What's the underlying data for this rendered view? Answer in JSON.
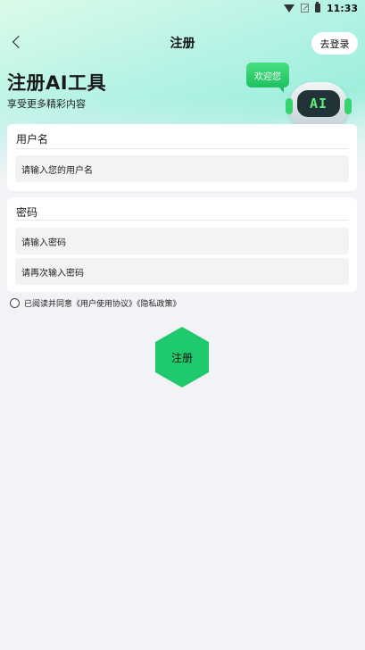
{
  "status_bar": {
    "time": "11:33",
    "icons": [
      "wifi-icon",
      "no-signal-icon",
      "battery-icon"
    ]
  },
  "nav": {
    "back_icon": "chevron-left-icon",
    "title": "注册",
    "login_label": "去登录"
  },
  "hero": {
    "title": "注册AI工具",
    "subtitle": "享受更多精彩内容",
    "bubble_text": "欢迎您",
    "robot_face_text": "AI"
  },
  "username_section": {
    "label": "用户名",
    "input_placeholder": "请输入您的用户名"
  },
  "password_section": {
    "label": "密码",
    "password_placeholder": "请输入密码",
    "confirm_placeholder": "请再次输入密码"
  },
  "agreement": {
    "text": "已阅读并同意《用户使用协议》《隐私政策》",
    "checked": false
  },
  "register_button": {
    "label": "注册",
    "color": "#1fca6c"
  },
  "colors": {
    "accent_green": "#1fca6c",
    "background": "#f2f3f6",
    "card": "#ffffff"
  }
}
